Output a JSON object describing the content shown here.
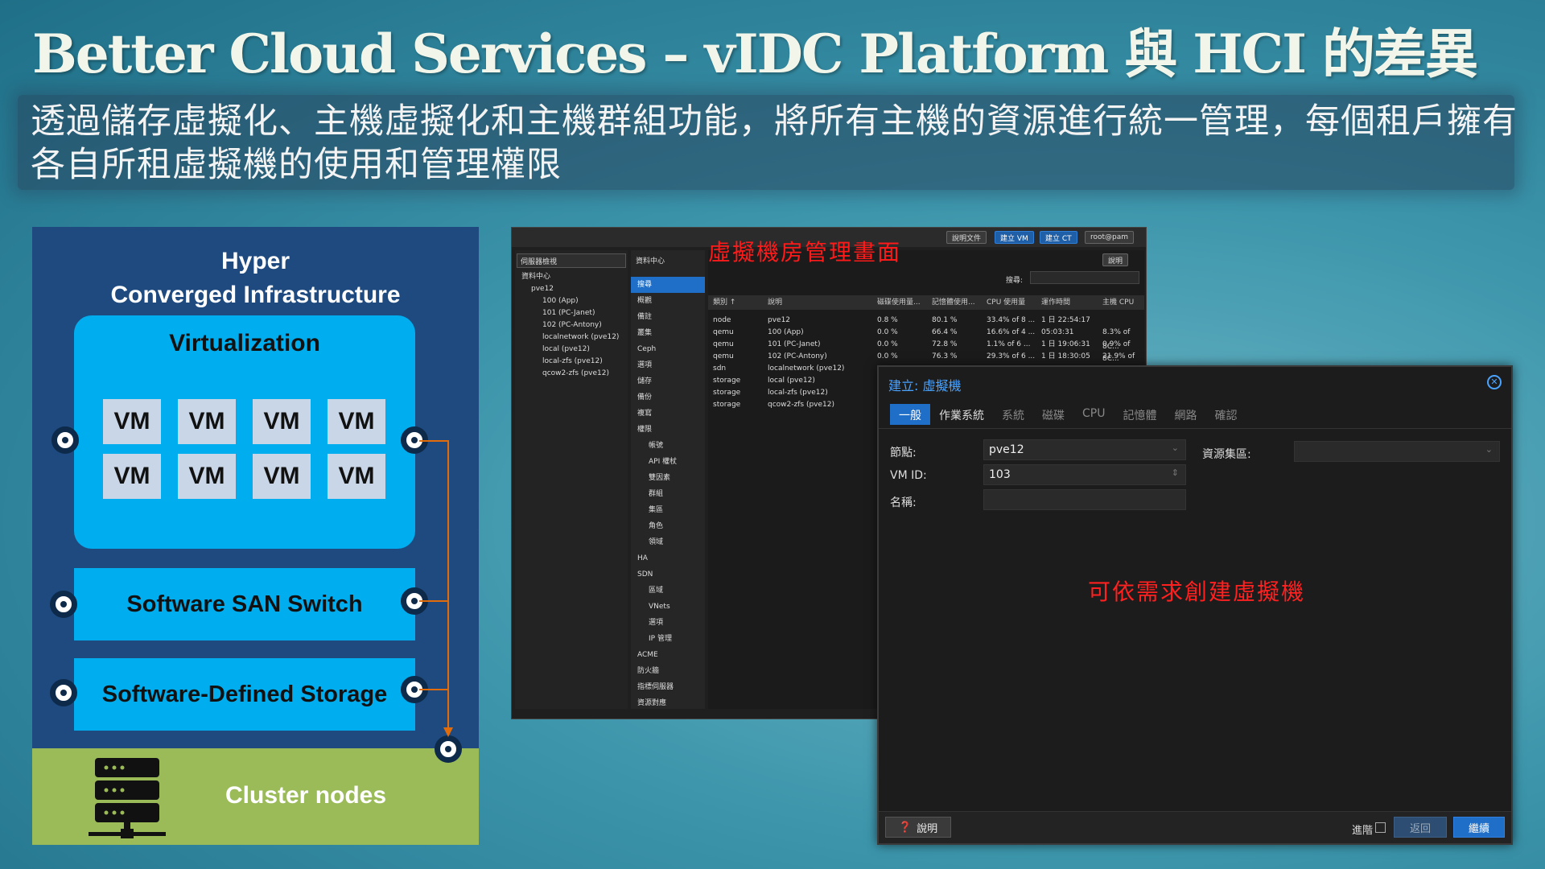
{
  "title": "Better Cloud Services – vIDC Platform 與 HCI 的差異",
  "subtitle": "透過儲存虛擬化、主機虛擬化和主機群組功能，將所有主機的資源進行統一管理，每個租戶擁有各自所租虛擬機的使用和管理權限",
  "hci": {
    "title_line1": "Hyper",
    "title_line2": "Converged Infrastructure",
    "virtualization": "Virtualization",
    "vm_label": "VM",
    "san": "Software SAN Switch",
    "sds": "Software-Defined Storage",
    "cluster": "Cluster nodes"
  },
  "mgmt": {
    "label": "虛擬機房管理畫面",
    "top_buttons": [
      "說明文件",
      "建立 VM",
      "建立 CT",
      "root@pam"
    ],
    "tree_view": "伺服器檢視",
    "tree": [
      "資料中心",
      "pve12",
      "100 (App)",
      "101 (PC-Janet)",
      "102 (PC-Antony)",
      "localnetwork (pve12)",
      "local (pve12)",
      "local-zfs (pve12)",
      "qcow2-zfs (pve12)"
    ],
    "menu_head": "資料中心",
    "menu": [
      "搜尋",
      "概觀",
      "備註",
      "叢集",
      "Ceph",
      "選項",
      "儲存",
      "備份",
      "複寫",
      "權限",
      "帳號",
      "API 權杖",
      "雙因素",
      "群組",
      "集區",
      "角色",
      "領域",
      "HA",
      "SDN",
      "區域",
      "VNets",
      "選項",
      "IP 管理",
      "ACME",
      "防火牆",
      "指標伺服器",
      "資源對應"
    ],
    "help": "說明",
    "search_label": "搜尋:",
    "columns": [
      "類別 ↑",
      "說明",
      "磁碟使用量...",
      "記憶體使用...",
      "CPU 使用量",
      "運作時間",
      "主機 CPU"
    ],
    "rows": [
      [
        "node",
        "pve12",
        "0.8 %",
        "80.1 %",
        "33.4% of 8 ...",
        "1 日 22:54:17",
        ""
      ],
      [
        "qemu",
        "100 (App)",
        "0.0 %",
        "66.4 %",
        "16.6% of 4 ...",
        "05:03:31",
        "8.3% of 8C..."
      ],
      [
        "qemu",
        "101 (PC-Janet)",
        "0.0 %",
        "72.8 %",
        "1.1% of 6 ...",
        "1 日 19:06:31",
        "0.9% of 8C..."
      ],
      [
        "qemu",
        "102 (PC-Antony)",
        "0.0 %",
        "76.3 %",
        "29.3% of 6 ...",
        "1 日 18:30:05",
        "21.9% of 8..."
      ],
      [
        "sdn",
        "localnetwork (pve12)",
        "",
        "",
        "",
        "",
        ""
      ],
      [
        "storage",
        "local (pve12)",
        "",
        "",
        "",
        "",
        ""
      ],
      [
        "storage",
        "local-zfs (pve12)",
        "",
        "",
        "",
        "",
        ""
      ],
      [
        "storage",
        "qcow2-zfs (pve12)",
        "",
        "",
        "",
        "",
        ""
      ]
    ]
  },
  "dialog": {
    "title": "建立: 虛擬機",
    "tabs": [
      "一般",
      "作業系統",
      "系統",
      "磁碟",
      "CPU",
      "記憶體",
      "網路",
      "確認"
    ],
    "node_label": "節點:",
    "node_value": "pve12",
    "vmid_label": "VM ID:",
    "vmid_value": "103",
    "name_label": "名稱:",
    "pool_label": "資源集區:",
    "note": "可依需求創建虛擬機",
    "help": "說明",
    "advanced": "進階",
    "back": "返回",
    "next": "繼續"
  }
}
